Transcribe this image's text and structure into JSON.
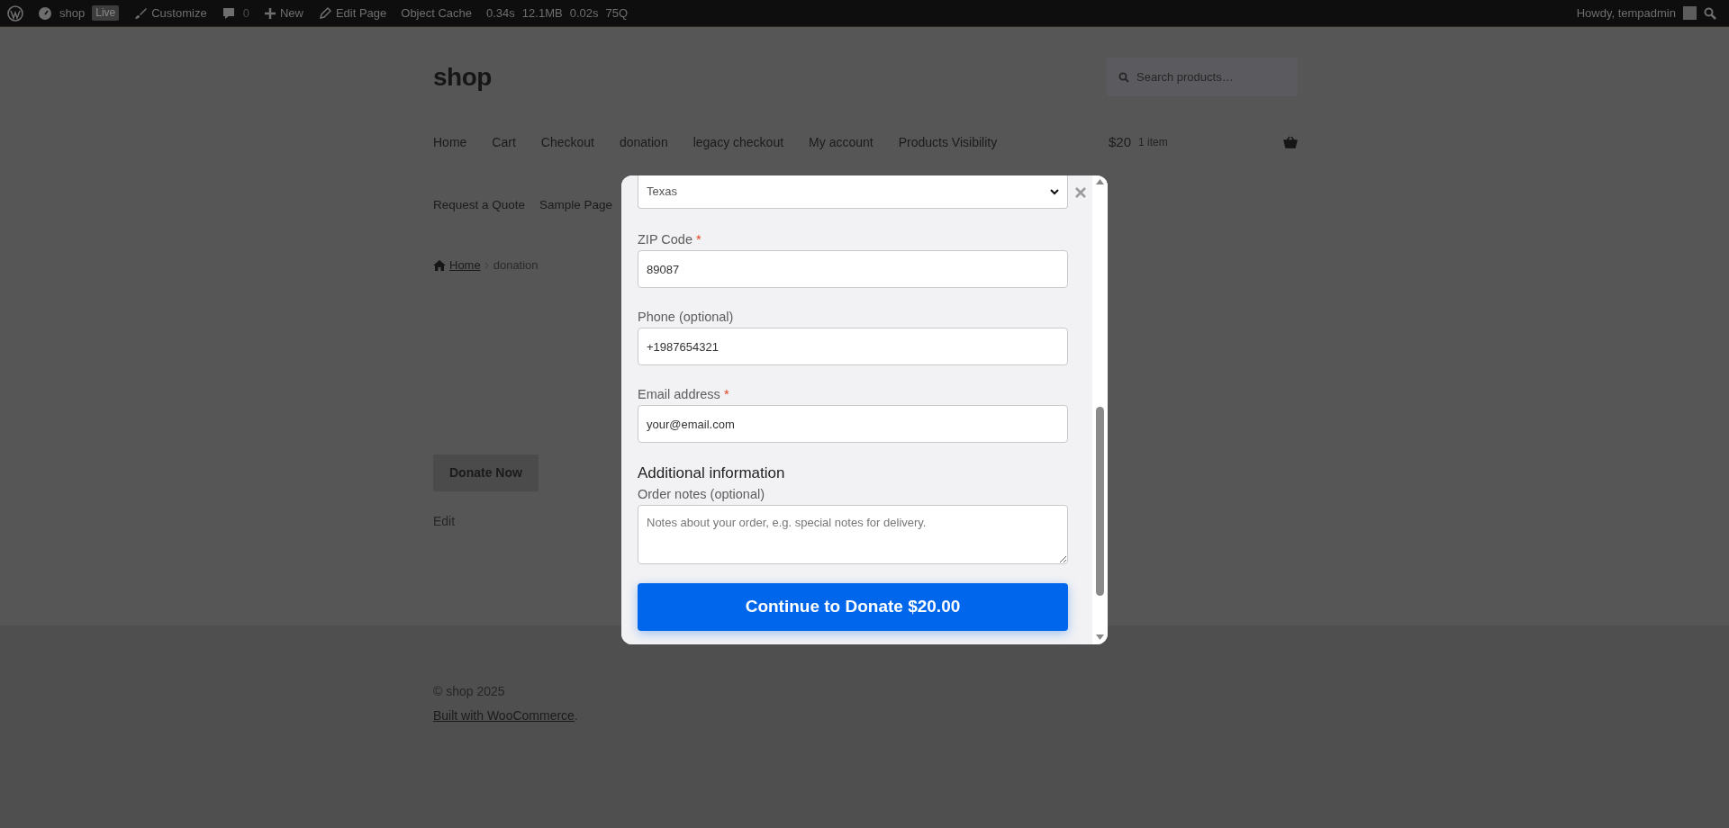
{
  "admin_bar": {
    "site": "shop",
    "live_badge": "Live",
    "customize": "Customize",
    "comments_count": "0",
    "new": "New",
    "edit_page": "Edit Page",
    "object_cache": "Object Cache",
    "stats": [
      "0.34s",
      "12.1MB",
      "0.02s",
      "75Q"
    ],
    "greeting": "Howdy, tempadmin"
  },
  "header": {
    "site_title": "shop",
    "search": {
      "placeholder": "Search products…"
    },
    "nav": [
      {
        "label": "Home"
      },
      {
        "label": "Cart"
      },
      {
        "label": "Checkout"
      },
      {
        "label": "donation"
      },
      {
        "label": "legacy checkout"
      },
      {
        "label": "My account"
      },
      {
        "label": "Products Visibility"
      }
    ],
    "nav_second_row": [
      {
        "label": "Request a Quote"
      },
      {
        "label": "Sample Page"
      }
    ],
    "cart": {
      "amount": "$20",
      "count": "1 item"
    }
  },
  "breadcrumb": [
    {
      "label": "Home",
      "link": true
    },
    {
      "label": "donation",
      "link": false
    }
  ],
  "content": {
    "donate_button": "Donate Now",
    "edit_link": "Edit"
  },
  "footer": {
    "copyright": "© shop 2025",
    "credit_link": "Built with WooCommerce",
    "credit_after": "."
  },
  "modal": {
    "state_select": {
      "value": "Texas"
    },
    "required_mark": "*",
    "fields": [
      {
        "label": "ZIP Code",
        "required": true,
        "value": "89087"
      },
      {
        "label": "Phone (optional)",
        "required": false,
        "value": "+1987654321"
      },
      {
        "label": "Email address",
        "required": true,
        "value": "your@email.com"
      }
    ],
    "section_heading": "Additional information",
    "notes": {
      "label": "Order notes (optional)",
      "placeholder": "Notes about your order, e.g. special notes for delivery."
    },
    "submit_button": "Continue to Donate $20.00"
  }
}
